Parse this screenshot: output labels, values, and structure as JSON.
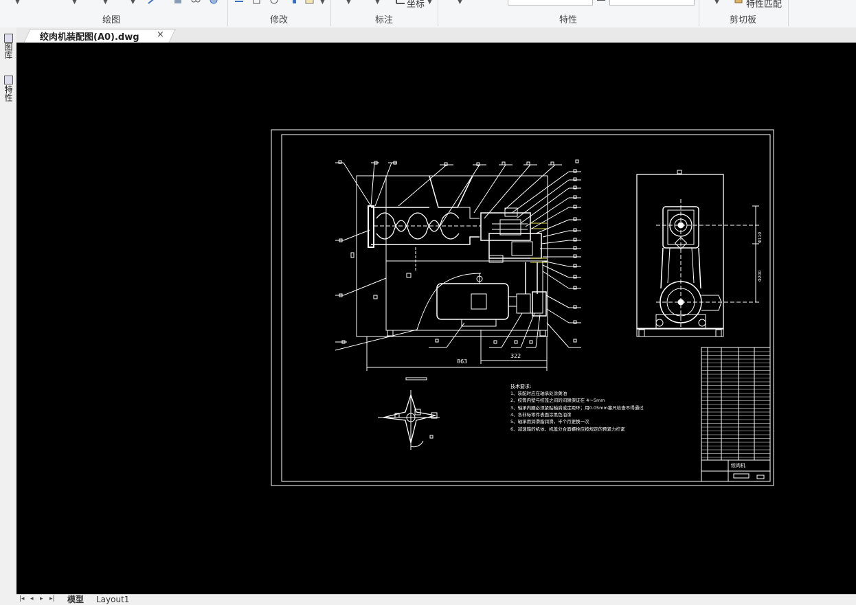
{
  "ribbon": {
    "groups": [
      {
        "label": "绘图"
      },
      {
        "label": "修改"
      },
      {
        "label": "标注"
      },
      {
        "label": "特性"
      },
      {
        "label": "剪切板"
      }
    ],
    "coord_button": "坐标",
    "match_button": "特性匹配"
  },
  "tabs": {
    "document": "绞肉机装配图(A0).dwg",
    "close": "×"
  },
  "left_palettes": [
    {
      "label": "图库",
      "icon": "library-icon"
    },
    {
      "label": "特性",
      "icon": "properties-icon"
    }
  ],
  "drawing": {
    "dim_total": "863",
    "dim_right": "322",
    "tech_title": "技术要求:",
    "tech_notes": [
      "1、装配时应在轴承处涂黄油",
      "2、绞筒内壁与绞笼之间的间隙保证在 4～5mm",
      "3、轴承内圈必须紧贴轴肩或定距环；用0.05mm塞尺检查不得通过",
      "4、各非标零件表面涂黑色油漆",
      "5、轴承用润滑脂润滑，半个月更换一次",
      "6、减速箱的机体、机盖分合面螺栓应按规定的预紧力拧紧"
    ],
    "title_block_name": "绞肉机",
    "side_dim_top": "Φ110",
    "side_dim_mid": "Φ200"
  },
  "layout_tabs": [
    {
      "label": "模型",
      "active": true
    },
    {
      "label": "Layout1",
      "active": false
    }
  ],
  "colors": {
    "canvas": "#000000",
    "lines": "#ffffff",
    "highlight": "#e8e85a"
  }
}
